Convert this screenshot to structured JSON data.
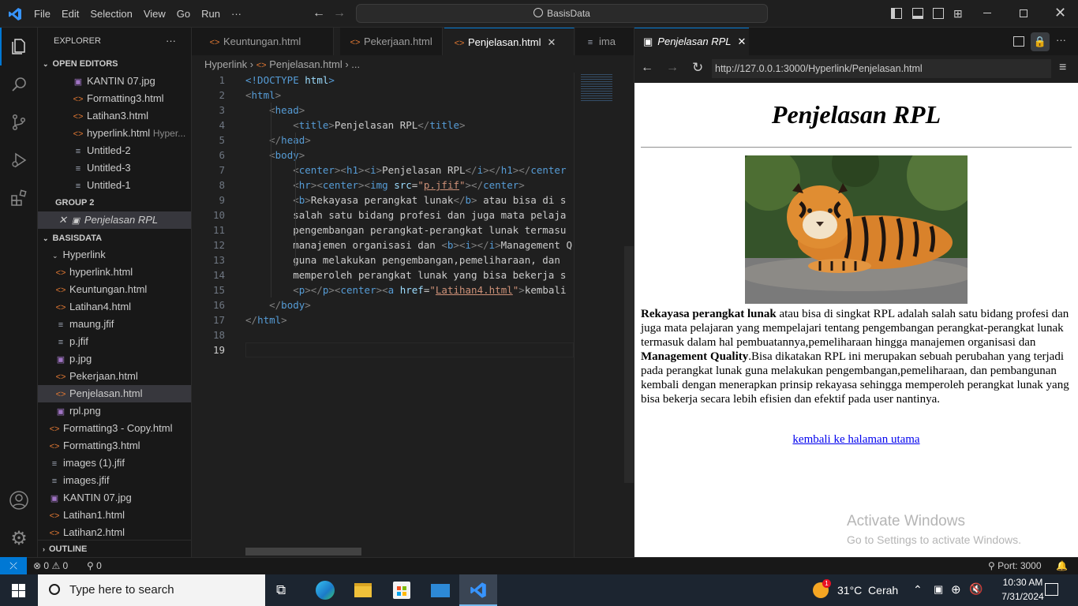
{
  "titlebar": {
    "menus": [
      "File",
      "Edit",
      "Selection",
      "View",
      "Go",
      "Run",
      "···"
    ],
    "search": "BasisData"
  },
  "explorer": {
    "title": "EXPLORER",
    "more": "···",
    "open_editors": {
      "label": "OPEN EDITORS",
      "items": [
        {
          "name": "KANTIN 07.jpg",
          "icon": "image-icon"
        },
        {
          "name": "Formatting3.html",
          "icon": "html-icon"
        },
        {
          "name": "Latihan3.html",
          "icon": "html-icon"
        },
        {
          "name": "hyperlink.html",
          "desc": "Hyper...",
          "icon": "html-icon"
        },
        {
          "name": "Untitled-2",
          "icon": "text-icon"
        },
        {
          "name": "Untitled-3",
          "icon": "text-icon"
        },
        {
          "name": "Untitled-1",
          "icon": "text-icon"
        }
      ],
      "group2_label": "GROUP 2",
      "group2_item": "Penjelasan RPL"
    },
    "project": {
      "label": "BASISDATA",
      "folder": "Hyperlink",
      "folder_items": [
        {
          "name": "hyperlink.html",
          "icon": "html-icon"
        },
        {
          "name": "Keuntungan.html",
          "icon": "html-icon"
        },
        {
          "name": "Latihan4.html",
          "icon": "html-icon"
        },
        {
          "name": "maung.jfif",
          "icon": "text-icon"
        },
        {
          "name": "p.jfif",
          "icon": "text-icon"
        },
        {
          "name": "p.jpg",
          "icon": "image-icon"
        },
        {
          "name": "Pekerjaan.html",
          "icon": "html-icon"
        },
        {
          "name": "Penjelasan.html",
          "icon": "html-icon"
        },
        {
          "name": "rpl.png",
          "icon": "image-icon"
        }
      ],
      "root_items": [
        {
          "name": "Formatting3 - Copy.html",
          "icon": "html-icon"
        },
        {
          "name": "Formatting3.html",
          "icon": "html-icon"
        },
        {
          "name": "images (1).jfif",
          "icon": "text-icon"
        },
        {
          "name": "images.jfif",
          "icon": "text-icon"
        },
        {
          "name": "KANTIN 07.jpg",
          "icon": "image-icon"
        },
        {
          "name": "Latihan1.html",
          "icon": "html-icon"
        },
        {
          "name": "Latihan2.html",
          "icon": "html-icon"
        }
      ]
    },
    "outline": "OUTLINE"
  },
  "editor": {
    "tabs": [
      "Keuntungan.html",
      "Pekerjaan.html",
      "Penjelasan.html",
      "ima"
    ],
    "breadcrumb": [
      "Hyperlink",
      "Penjelasan.html",
      "..."
    ],
    "lines": [
      [
        [
          "dt",
          "<!DOCTYPE "
        ],
        [
          "at",
          "html"
        ],
        [
          "dt",
          ">"
        ]
      ],
      [
        [
          "tgx",
          "<"
        ],
        [
          "tg",
          "html"
        ],
        [
          "tgx",
          ">"
        ]
      ],
      [
        [
          "tx",
          "    "
        ],
        [
          "tgx",
          "<"
        ],
        [
          "tg",
          "head"
        ],
        [
          "tgx",
          ">"
        ]
      ],
      [
        [
          "tx",
          "        "
        ],
        [
          "tgx",
          "<"
        ],
        [
          "tg",
          "title"
        ],
        [
          "tgx",
          ">"
        ],
        [
          "tx",
          "Penjelasan RPL"
        ],
        [
          "tgx",
          "</"
        ],
        [
          "tg",
          "title"
        ],
        [
          "tgx",
          ">"
        ]
      ],
      [
        [
          "tx",
          "    "
        ],
        [
          "tgx",
          "</"
        ],
        [
          "tg",
          "head"
        ],
        [
          "tgx",
          ">"
        ]
      ],
      [
        [
          "tx",
          "    "
        ],
        [
          "tgx",
          "<"
        ],
        [
          "tg",
          "body"
        ],
        [
          "tgx",
          ">"
        ]
      ],
      [
        [
          "tx",
          "        "
        ],
        [
          "tgx",
          "<"
        ],
        [
          "tg",
          "center"
        ],
        [
          "tgx",
          "><"
        ],
        [
          "tg",
          "h1"
        ],
        [
          "tgx",
          "><"
        ],
        [
          "tg",
          "i"
        ],
        [
          "tgx",
          ">"
        ],
        [
          "tx",
          "Penjelasan RPL"
        ],
        [
          "tgx",
          "</"
        ],
        [
          "tg",
          "i"
        ],
        [
          "tgx",
          "></"
        ],
        [
          "tg",
          "h1"
        ],
        [
          "tgx",
          "></"
        ],
        [
          "tg",
          "center"
        ]
      ],
      [
        [
          "tx",
          "        "
        ],
        [
          "tgx",
          "<"
        ],
        [
          "tg",
          "hr"
        ],
        [
          "tgx",
          "><"
        ],
        [
          "tg",
          "center"
        ],
        [
          "tgx",
          "><"
        ],
        [
          "tg",
          "img"
        ],
        [
          "tx",
          " "
        ],
        [
          "at",
          "src"
        ],
        [
          "tx",
          "="
        ],
        [
          "st",
          "\""
        ],
        [
          "stu",
          "p.jfif"
        ],
        [
          "st",
          "\""
        ],
        [
          "tgx",
          "></"
        ],
        [
          "tg",
          "center"
        ],
        [
          "tgx",
          ">"
        ]
      ],
      [
        [
          "tx",
          "        "
        ],
        [
          "tgx",
          "<"
        ],
        [
          "tg",
          "b"
        ],
        [
          "tgx",
          ">"
        ],
        [
          "tx",
          "Rekayasa perangkat lunak"
        ],
        [
          "tgx",
          "</"
        ],
        [
          "tg",
          "b"
        ],
        [
          "tgx",
          ">"
        ],
        [
          "tx",
          " atau bisa di s"
        ]
      ],
      [
        [
          "tx",
          "        salah satu bidang profesi dan juga mata pelaja"
        ]
      ],
      [
        [
          "tx",
          "        pengembangan perangkat-perangkat lunak termasu"
        ]
      ],
      [
        [
          "tx",
          "        manajemen organisasi dan "
        ],
        [
          "tgx",
          "<"
        ],
        [
          "tg",
          "b"
        ],
        [
          "tgx",
          "><"
        ],
        [
          "tg",
          "i"
        ],
        [
          "tgx",
          "></"
        ],
        [
          "tg",
          "i"
        ],
        [
          "tgx",
          ">"
        ],
        [
          "tx",
          "Management Q"
        ]
      ],
      [
        [
          "tx",
          "        guna melakukan pengembangan,pemeliharaan, dan"
        ]
      ],
      [
        [
          "tx",
          "        memperoleh perangkat lunak yang bisa bekerja s"
        ]
      ],
      [
        [
          "tx",
          "        "
        ],
        [
          "tgx",
          "<"
        ],
        [
          "tg",
          "p"
        ],
        [
          "tgx",
          "></"
        ],
        [
          "tg",
          "p"
        ],
        [
          "tgx",
          "><"
        ],
        [
          "tg",
          "center"
        ],
        [
          "tgx",
          "><"
        ],
        [
          "tg",
          "a"
        ],
        [
          "tx",
          " "
        ],
        [
          "at",
          "href"
        ],
        [
          "tx",
          "="
        ],
        [
          "st",
          "\""
        ],
        [
          "stu",
          "Latihan4.html"
        ],
        [
          "st",
          "\""
        ],
        [
          "tgx",
          ">"
        ],
        [
          "tx",
          "kembali"
        ]
      ],
      [
        [
          "tx",
          "    "
        ],
        [
          "tgx",
          "</"
        ],
        [
          "tg",
          "body"
        ],
        [
          "tgx",
          ">"
        ]
      ],
      [
        [
          "tgx",
          "</"
        ],
        [
          "tg",
          "html"
        ],
        [
          "tgx",
          ">"
        ]
      ],
      [],
      []
    ],
    "current_line": 19
  },
  "preview": {
    "tab_title": "Penjelasan RPL",
    "url": "http://127.0.0.1:3000/Hyperlink/Penjelasan.html",
    "heading": "Penjelasan RPL",
    "para_b1": "Rekayasa perangkat lunak",
    "para_t1": " atau bisa di singkat RPL adalah salah satu bidang profesi dan juga mata pelajaran yang mempelajari tentang pengembangan perangkat-perangkat lunak termasuk dalam hal pembuatannya,pemeliharaan hingga manajemen organisasi dan ",
    "para_b2": "Management Quality",
    "para_t2": ".Bisa dikatakan RPL ini merupakan sebuah perubahan yang terjadi pada perangkat lunak guna melakukan pengembangan,pemeliharaan, dan pembangunan kembali dengan menerapkan prinsip rekayasa sehingga memperoleh perangkat lunak yang bisa bekerja secara lebih efisien dan efektif pada user nantinya.",
    "link": "kembali ke halaman utama",
    "watermark_1": "Activate Windows",
    "watermark_2": "Go to Settings to activate Windows."
  },
  "statusbar": {
    "errors": "0",
    "warnings": "0",
    "ports": "0",
    "port": "Port: 3000"
  },
  "taskbar": {
    "search_placeholder": "Type here to search",
    "weather": "31°C  Cerah",
    "weather_badge": "1",
    "time": "10:30 AM",
    "date": "7/31/2024"
  },
  "colors": {
    "accent": "#0078d4",
    "html_icon": "#e37933",
    "image_icon": "#a074c4",
    "link": "#0000ee"
  }
}
